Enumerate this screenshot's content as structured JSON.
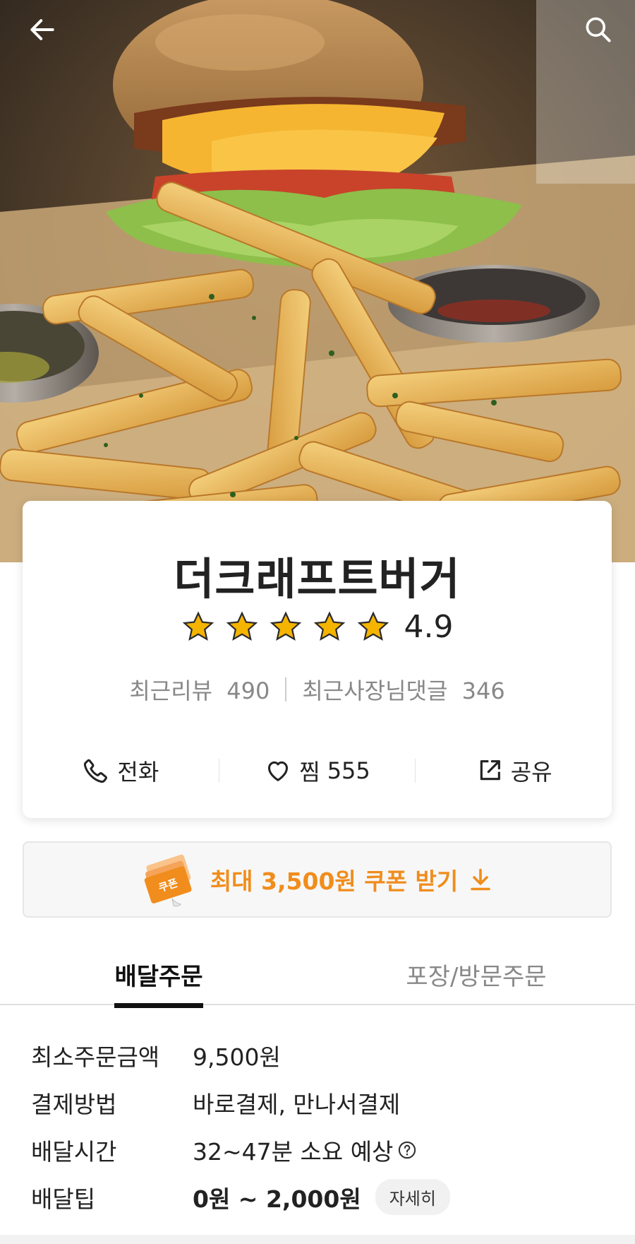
{
  "store": {
    "name": "더크래프트버거",
    "rating": "4.9",
    "stars": 5,
    "recent_reviews_label": "최근리뷰",
    "recent_reviews_count": "490",
    "owner_replies_label": "최근사장님댓글",
    "owner_replies_count": "346"
  },
  "actions": {
    "call_label": "전화",
    "like_label": "찜",
    "like_count": "555",
    "share_label": "공유"
  },
  "coupon": {
    "badge_text": "쿠폰",
    "label": "최대 3,500원 쿠폰 받기"
  },
  "tabs": [
    {
      "label": "배달주문",
      "active": true
    },
    {
      "label": "포장/방문주문",
      "active": false
    }
  ],
  "details": {
    "min_order_label": "최소주문금액",
    "min_order_value": "9,500원",
    "payment_label": "결제방법",
    "payment_value": "바로결제, 만나서결제",
    "time_label": "배달시간",
    "time_value": "32~47분 소요 예상",
    "tip_label": "배달팁",
    "tip_value": "0원 ~ 2,000원",
    "tip_detail_button": "자세히"
  },
  "colors": {
    "accent": "#f08d1c",
    "star": "#f5b400",
    "text": "#222222",
    "muted": "#888888"
  },
  "icons": {
    "back": "arrow-left-icon",
    "search": "search-icon",
    "call": "phone-icon",
    "like": "heart-icon",
    "share": "share-icon",
    "coupon_download": "download-arrow-icon",
    "help": "question-circle-icon"
  }
}
